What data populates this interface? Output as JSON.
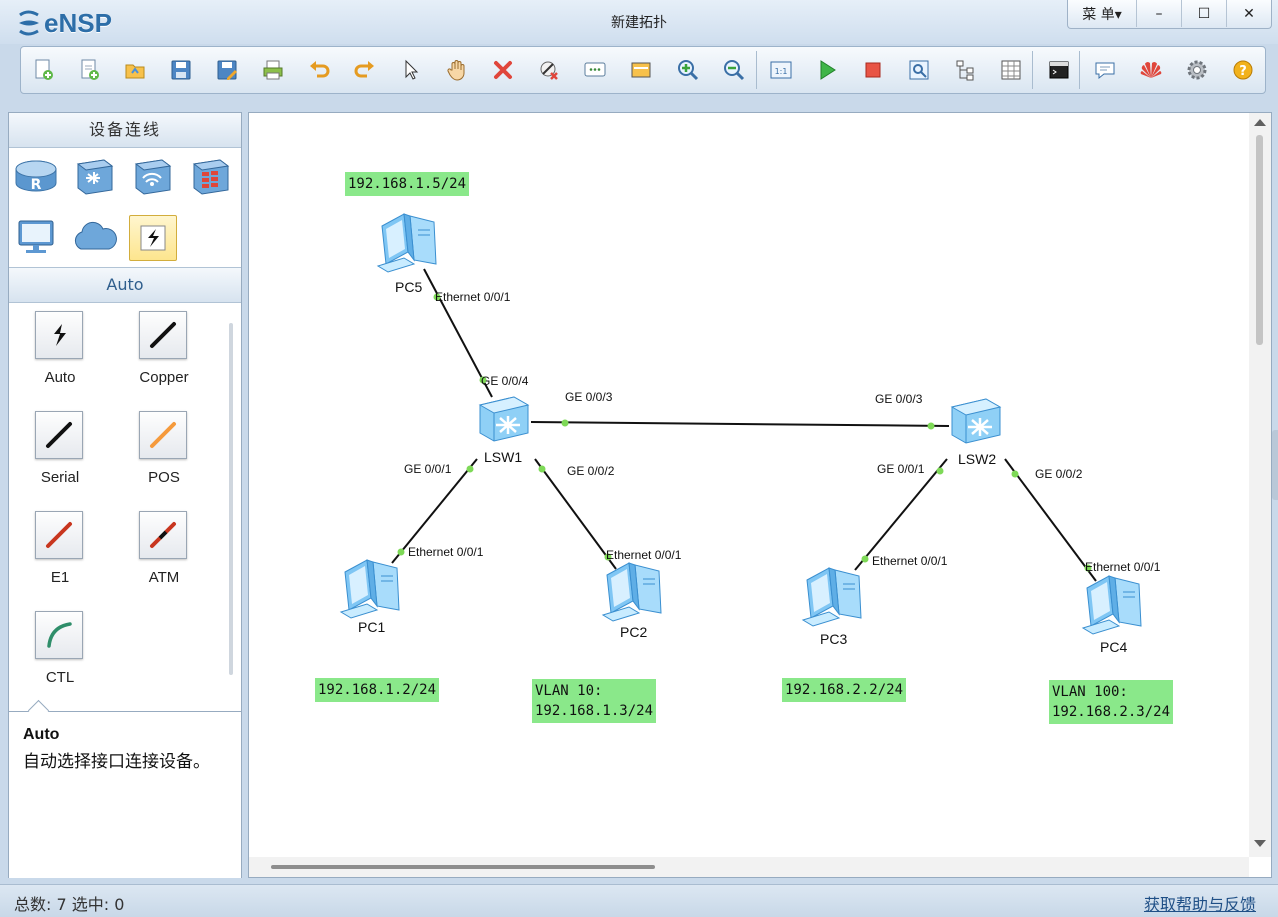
{
  "app": {
    "logo_text": "eNSP",
    "window_title": "新建拓扑"
  },
  "window_controls": {
    "menu_label": "菜 单▾",
    "minimize": "–",
    "maximize": "☐",
    "close": "✕"
  },
  "toolbar": {
    "buttons": [
      "new-topology-icon",
      "new-sample-icon",
      "open-icon",
      "save-icon",
      "save-as-icon",
      "print-icon",
      "undo-icon",
      "redo-icon",
      "select-pointer-icon",
      "pan-hand-icon",
      "delete-icon",
      "delete-link-icon",
      "text-annotation-icon",
      "rectangle-icon",
      "zoom-in-icon",
      "zoom-out-icon",
      "fit-view-icon",
      "start-device-icon",
      "stop-device-icon",
      "capture-icon",
      "topology-tree-icon",
      "grid-icon",
      "console-icon",
      "chat-icon",
      "huawei-icon",
      "settings-icon",
      "help-icon"
    ]
  },
  "left_panel": {
    "header": "设备连线",
    "categories": [
      "router-icon",
      "switch-icon",
      "wireless-icon",
      "firewall-icon",
      "pc-terminal-icon",
      "cloud-icon",
      "connection-icon"
    ],
    "section_title": "Auto",
    "connections": [
      {
        "label": "Auto",
        "icon": "auto-connection-icon"
      },
      {
        "label": "Copper",
        "icon": "copper-cable-icon"
      },
      {
        "label": "Serial",
        "icon": "serial-cable-icon"
      },
      {
        "label": "POS",
        "icon": "pos-cable-icon"
      },
      {
        "label": "E1",
        "icon": "e1-cable-icon"
      },
      {
        "label": "ATM",
        "icon": "atm-cable-icon"
      },
      {
        "label": "CTL",
        "icon": "ctl-cable-icon"
      }
    ],
    "description": {
      "title": "Auto",
      "text": "自动选择接口连接设备。"
    }
  },
  "topology": {
    "devices": [
      {
        "id": "PC5",
        "type": "pc"
      },
      {
        "id": "LSW1",
        "type": "switch"
      },
      {
        "id": "LSW2",
        "type": "switch"
      },
      {
        "id": "PC1",
        "type": "pc"
      },
      {
        "id": "PC2",
        "type": "pc"
      },
      {
        "id": "PC3",
        "type": "pc"
      },
      {
        "id": "PC4",
        "type": "pc"
      }
    ],
    "links": [
      {
        "a": "PC5",
        "a_port": "Ethernet 0/0/1",
        "b": "LSW1",
        "b_port": "GE 0/0/4"
      },
      {
        "a": "LSW1",
        "a_port": "GE 0/0/3",
        "b": "LSW2",
        "b_port": "GE 0/0/3"
      },
      {
        "a": "LSW1",
        "a_port": "GE 0/0/1",
        "b": "PC1",
        "b_port": "Ethernet 0/0/1"
      },
      {
        "a": "LSW1",
        "a_port": "GE 0/0/2",
        "b": "PC2",
        "b_port": "Ethernet 0/0/1"
      },
      {
        "a": "LSW2",
        "a_port": "GE 0/0/1",
        "b": "PC3",
        "b_port": "Ethernet 0/0/1"
      },
      {
        "a": "LSW2",
        "a_port": "GE 0/0/2",
        "b": "PC4",
        "b_port": "Ethernet 0/0/1"
      }
    ],
    "ip_labels": [
      {
        "text": "192.168.1.5/24"
      },
      {
        "text": "192.168.1.2/24"
      },
      {
        "text": "VLAN 10:\n192.168.1.3/24"
      },
      {
        "text": "192.168.2.2/24"
      },
      {
        "text": "VLAN 100:\n192.168.2.3/24"
      }
    ],
    "colors": {
      "link": "#111111",
      "port_dot": "#7ed957",
      "ip_label_bg": "#8ae88a"
    }
  },
  "status_bar": {
    "left": "总数: 7 选中: 0",
    "right": "获取帮助与反馈"
  }
}
